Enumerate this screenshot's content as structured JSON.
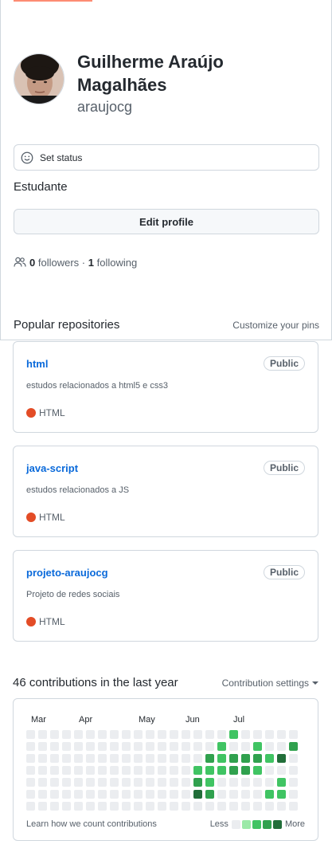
{
  "profile": {
    "full_name": "Guilherme Araújo Magalhães",
    "username": "araujocg",
    "status_label": "Set status",
    "bio": "Estudante",
    "edit_label": "Edit profile",
    "followers_count": "0",
    "followers_label": "followers",
    "separator": "·",
    "following_count": "1",
    "following_label": "following"
  },
  "popular": {
    "title": "Popular repositories",
    "customize_label": "Customize your pins",
    "repos": [
      {
        "name": "html",
        "visibility": "Public",
        "description": "estudos relacionados a html5 e css3",
        "language": "HTML",
        "language_color": "#e34c26"
      },
      {
        "name": "java-script",
        "visibility": "Public",
        "description": "estudos relacionados a JS",
        "language": "HTML",
        "language_color": "#e34c26"
      },
      {
        "name": "projeto-araujocg",
        "visibility": "Public",
        "description": "Projeto de redes sociais",
        "language": "HTML",
        "language_color": "#e34c26"
      }
    ]
  },
  "contributions": {
    "title": "46 contributions in the last year",
    "settings_label": "Contribution settings",
    "months": [
      "Mar",
      "Apr",
      "May",
      "Jun",
      "Jul"
    ],
    "learn_label": "Learn how we count contributions",
    "legend_less": "Less",
    "legend_more": "More",
    "level_colors": [
      "#ebedf0",
      "#9be9a8",
      "#40c463",
      "#30a14e",
      "#216e39"
    ],
    "grid": [
      [
        0,
        0,
        0,
        0,
        0,
        0,
        0
      ],
      [
        0,
        0,
        0,
        0,
        0,
        0,
        0
      ],
      [
        0,
        0,
        0,
        0,
        0,
        0,
        0
      ],
      [
        0,
        0,
        0,
        0,
        0,
        0,
        0
      ],
      [
        0,
        0,
        0,
        0,
        0,
        0,
        0
      ],
      [
        0,
        0,
        0,
        0,
        0,
        0,
        0
      ],
      [
        0,
        0,
        0,
        0,
        0,
        0,
        0
      ],
      [
        0,
        0,
        0,
        0,
        0,
        0,
        0
      ],
      [
        0,
        0,
        0,
        0,
        0,
        0,
        0
      ],
      [
        0,
        0,
        0,
        0,
        0,
        0,
        0
      ],
      [
        0,
        0,
        0,
        0,
        0,
        0,
        0
      ],
      [
        0,
        0,
        0,
        0,
        0,
        0,
        0
      ],
      [
        0,
        0,
        0,
        0,
        0,
        0,
        0
      ],
      [
        0,
        0,
        0,
        0,
        0,
        0,
        0
      ],
      [
        0,
        0,
        0,
        2,
        3,
        4,
        0
      ],
      [
        0,
        0,
        3,
        2,
        2,
        3,
        0
      ],
      [
        0,
        2,
        2,
        2,
        0,
        0,
        0
      ],
      [
        2,
        0,
        3,
        3,
        0,
        0,
        0
      ],
      [
        0,
        0,
        3,
        3,
        0,
        0,
        0
      ],
      [
        0,
        2,
        3,
        2,
        0,
        0,
        0
      ],
      [
        0,
        0,
        2,
        0,
        0,
        2,
        0
      ],
      [
        0,
        0,
        4,
        0,
        2,
        2,
        0
      ],
      [
        0,
        3,
        0,
        0,
        0,
        0,
        0
      ]
    ]
  }
}
